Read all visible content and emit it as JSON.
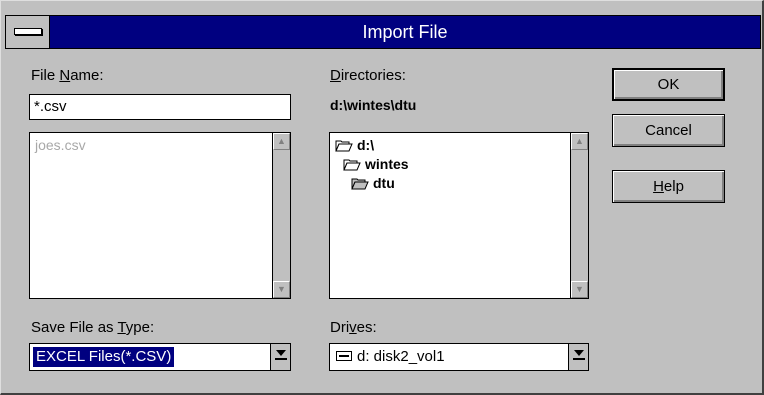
{
  "window": {
    "title": "Import File"
  },
  "file_name": {
    "label_pre": "File ",
    "label_accel": "N",
    "label_post": "ame:",
    "value": "*.csv",
    "files": [
      "joes.csv"
    ]
  },
  "directories": {
    "label_accel": "D",
    "label_post": "irectories:",
    "current_path": "d:\\wintes\\dtu",
    "tree": [
      {
        "name": "d:\\",
        "icon": "open-folder-icon"
      },
      {
        "name": "wintes",
        "icon": "open-folder-icon"
      },
      {
        "name": "dtu",
        "icon": "open-folder-icon"
      }
    ]
  },
  "file_type": {
    "label_pre": "Save File as ",
    "label_accel": "T",
    "label_post": "ype:",
    "selected": "EXCEL Files(*.CSV)"
  },
  "drives": {
    "label_pre": "Dri",
    "label_accel": "v",
    "label_post": "es:",
    "selected": "d: disk2_vol1"
  },
  "buttons": {
    "ok": "OK",
    "cancel": "Cancel",
    "help_accel": "H",
    "help_rest": "elp"
  },
  "colors": {
    "title_bar": "#000080",
    "face": "#c0c0c0",
    "selection": "#000080"
  }
}
